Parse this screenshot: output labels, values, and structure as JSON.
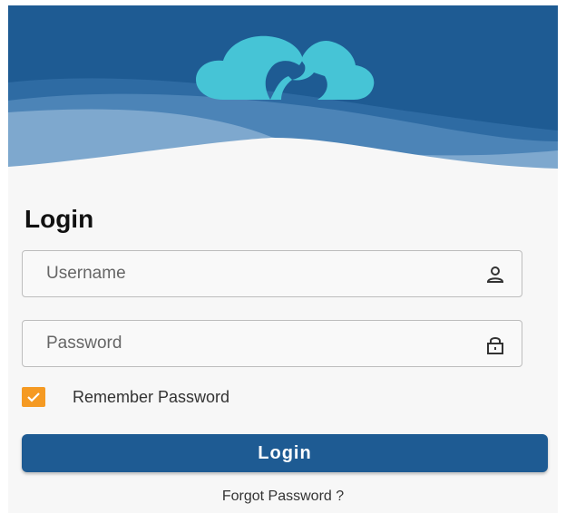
{
  "header": {
    "logo_icon": "cloud-music-icon",
    "background_color": "#1e5b93",
    "logo_color": "#46c4d6"
  },
  "login": {
    "title": "Login",
    "username": {
      "placeholder": "Username",
      "value": "",
      "icon": "user-icon"
    },
    "password": {
      "placeholder": "Password",
      "value": "",
      "icon": "lock-icon"
    },
    "remember": {
      "label": "Remember Password",
      "checked": true,
      "color": "#f59a23"
    },
    "button_label": "Login",
    "forgot_label": "Forgot Password ?"
  }
}
